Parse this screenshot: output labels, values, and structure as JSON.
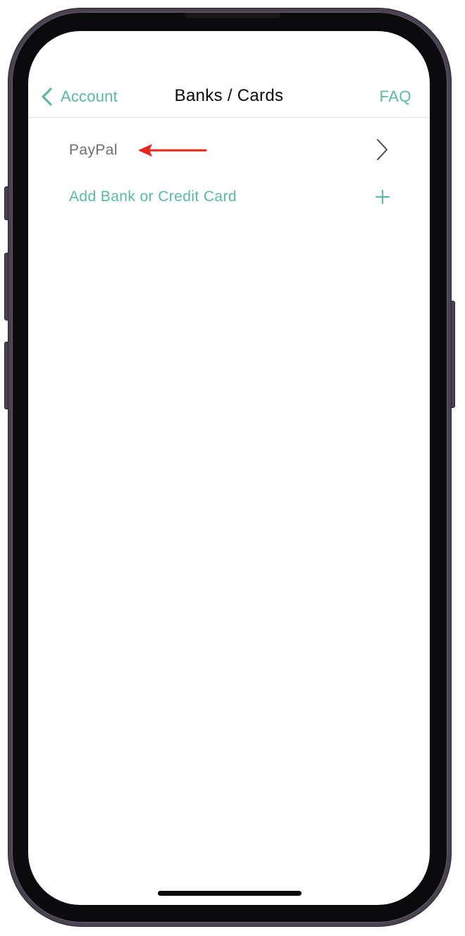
{
  "nav": {
    "back_label": "Account",
    "title": "Banks / Cards",
    "faq_label": "FAQ"
  },
  "list": {
    "items": [
      {
        "label": "PayPal",
        "accessory_icon": "chevron-right-icon"
      },
      {
        "label": "Add Bank or Credit Card",
        "accessory_icon": "plus-icon"
      }
    ]
  },
  "annotation": {
    "icon": "red-arrow-left",
    "color": "#e5261b"
  },
  "colors": {
    "accent": "#5bb9a3",
    "title_text": "#0a0a0a",
    "secondary_text": "#6e6e73",
    "device_frame": "#4a4151"
  }
}
